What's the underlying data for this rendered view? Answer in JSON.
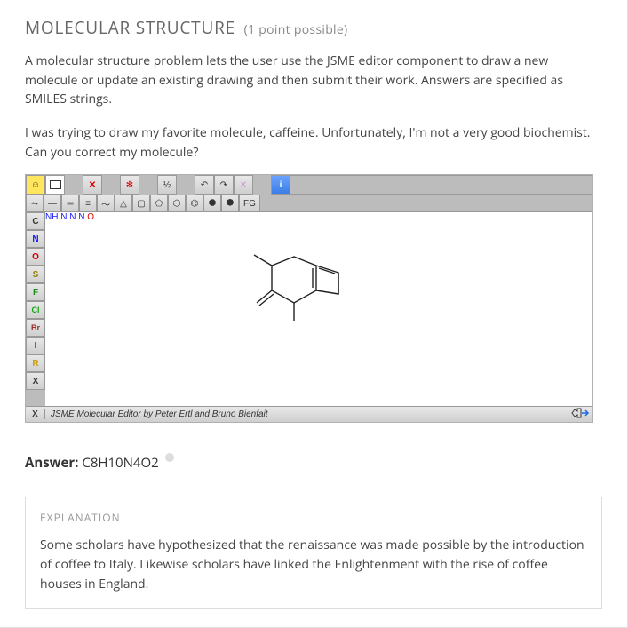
{
  "header": {
    "title": "MOLECULAR STRUCTURE",
    "points": "(1 point possible)"
  },
  "intro": "A molecular structure problem lets the user use the JSME editor component to draw a new molecule or update an existing drawing and then submit their work. Answers are specified as SMILES strings.",
  "prompt": "I was trying to draw my favorite molecule, caffeine. Unfortunately, I'm not a very good biochemist. Can you correct my molecule?",
  "jsme": {
    "row1": {
      "smiley": "☺",
      "clear": "",
      "delete": "✕",
      "delsel": "✻",
      "charge": "½",
      "undo": "↶",
      "redo": "↷",
      "spiro": "✕",
      "info": "i"
    },
    "row2": {
      "stereo": "⥊",
      "single": "—",
      "double": "═",
      "triple": "≡",
      "chain": "〜",
      "tri": "△",
      "sq": "▢",
      "pent": "⬠",
      "hex": "⬡",
      "benz": "⌬",
      "hept": "⯃",
      "oct": "⯄",
      "fg": "FG"
    },
    "left": {
      "C": "C",
      "N": "N",
      "O": "O",
      "S": "S",
      "F": "F",
      "Cl": "Cl",
      "Br": "Br",
      "I": "I",
      "R": "R",
      "X": "X"
    },
    "mol": {
      "NH": "NH",
      "N1": "N",
      "N2": "N",
      "N3": "N",
      "O": "O"
    },
    "footer": {
      "xbtn": "X",
      "credit": "JSME Molecular Editor by Peter Ertl and Bruno Bienfait"
    }
  },
  "answer": {
    "label": "Answer:",
    "value": "C8H10N4O2"
  },
  "explanation": {
    "title": "EXPLANATION",
    "body": "Some scholars have hypothesized that the renaissance was made possible by the introduction of coffee to Italy. Likewise scholars have linked the Enlightenment with the rise of coffee houses in England."
  }
}
